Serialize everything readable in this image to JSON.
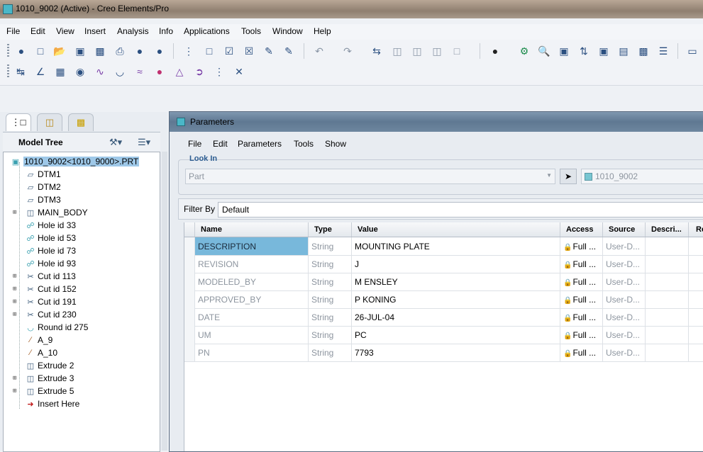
{
  "window": {
    "title": "1010_9002 (Active) - Creo Elements/Pro"
  },
  "menu": [
    "File",
    "Edit",
    "View",
    "Insert",
    "Analysis",
    "Info",
    "Applications",
    "Tools",
    "Window",
    "Help"
  ],
  "toolbar": {
    "row1": [
      "new-icon",
      "open-icon",
      "save-icon",
      "save-copy-icon",
      "print-icon",
      "send-icon",
      "email-icon",
      "close-window-icon",
      "activate-icon",
      "erase-icon",
      "regenerate-icon",
      "manager-icon",
      "undo-icon",
      "redo-icon",
      "copy-icon",
      "paste-icon",
      "paste-special-icon",
      "selection-icon",
      "sphere-icon",
      "datum-icon",
      "zoom-in-icon",
      "zoom-fit-icon",
      "reorient-icon",
      "view-manager-icon",
      "layers-icon",
      "shading-icon",
      "appearance-icon",
      "view-icon"
    ],
    "row2": [
      "measure-icon",
      "angle-icon",
      "area-icon",
      "mass-icon",
      "curve-icon",
      "surface-icon",
      "wave-icon",
      "color-icon",
      "draft-icon",
      "offset-icon",
      "refs-icon",
      "tools-icon"
    ]
  },
  "left_panel": {
    "tabs": [
      "model-tree-tab",
      "folder-browser-tab",
      "favorites-tab"
    ],
    "header": {
      "title": "Model Tree"
    },
    "tree": [
      {
        "label": "1010_9002<1010_9000>.PRT",
        "icon": "part-icon",
        "expandable": false
      },
      {
        "label": "DTM1",
        "icon": "datum-plane-icon",
        "expandable": false
      },
      {
        "label": "DTM2",
        "icon": "datum-plane-icon",
        "expandable": false
      },
      {
        "label": "DTM3",
        "icon": "datum-plane-icon",
        "expandable": false
      },
      {
        "label": "MAIN_BODY",
        "icon": "extrude-icon",
        "expandable": true
      },
      {
        "label": "Hole id 33",
        "icon": "hole-icon",
        "expandable": false
      },
      {
        "label": "Hole id 53",
        "icon": "hole-icon",
        "expandable": false
      },
      {
        "label": "Hole id 73",
        "icon": "hole-icon",
        "expandable": false
      },
      {
        "label": "Hole id 93",
        "icon": "hole-icon",
        "expandable": false
      },
      {
        "label": "Cut id 113",
        "icon": "cut-icon",
        "expandable": true
      },
      {
        "label": "Cut id 152",
        "icon": "cut-icon",
        "expandable": true
      },
      {
        "label": "Cut id 191",
        "icon": "cut-icon",
        "expandable": true
      },
      {
        "label": "Cut id 230",
        "icon": "cut-icon",
        "expandable": true
      },
      {
        "label": "Round id 275",
        "icon": "round-icon",
        "expandable": false
      },
      {
        "label": "A_9",
        "icon": "axis-icon",
        "expandable": false
      },
      {
        "label": "A_10",
        "icon": "axis-icon",
        "expandable": false
      },
      {
        "label": "Extrude 2",
        "icon": "extrude-icon",
        "expandable": false
      },
      {
        "label": "Extrude 3",
        "icon": "extrude-icon",
        "expandable": true
      },
      {
        "label": "Extrude 5",
        "icon": "extrude-icon",
        "expandable": true
      },
      {
        "label": "Insert Here",
        "icon": "insert-arrow-icon",
        "expandable": false
      }
    ]
  },
  "dialog": {
    "title": "Parameters",
    "menu": [
      "File",
      "Edit",
      "Parameters",
      "Tools",
      "Show"
    ],
    "look_in": {
      "label": "Look In",
      "type_value": "Part",
      "object_name": "1010_9002"
    },
    "filter": {
      "label": "Filter By",
      "value": "Default"
    },
    "columns": [
      "Name",
      "Type",
      "Value",
      "Access",
      "Source",
      "Descri...",
      "Re"
    ],
    "rows": [
      {
        "name": "DESCRIPTION",
        "type": "String",
        "value": "MOUNTING PLATE",
        "access": "Full ...",
        "source": "User-D...",
        "selected": true
      },
      {
        "name": "REVISION",
        "type": "String",
        "value": "J",
        "access": "Full ...",
        "source": "User-D...",
        "selected": false
      },
      {
        "name": "MODELED_BY",
        "type": "String",
        "value": "M ENSLEY",
        "access": "Full ...",
        "source": "User-D...",
        "selected": false
      },
      {
        "name": "APPROVED_BY",
        "type": "String",
        "value": "P KONING",
        "access": "Full ...",
        "source": "User-D...",
        "selected": false
      },
      {
        "name": "DATE",
        "type": "String",
        "value": "26-JUL-04",
        "access": "Full ...",
        "source": "User-D...",
        "selected": false
      },
      {
        "name": "UM",
        "type": "String",
        "value": "PC",
        "access": "Full ...",
        "source": "User-D...",
        "selected": false
      },
      {
        "name": "PN",
        "type": "String",
        "value": "7793",
        "access": "Full ...",
        "source": "User-D...",
        "selected": false
      }
    ]
  },
  "colors": {
    "selection": "#78b8db",
    "accent_label": "#2d5d91",
    "dialog_title": "#6d869f"
  }
}
